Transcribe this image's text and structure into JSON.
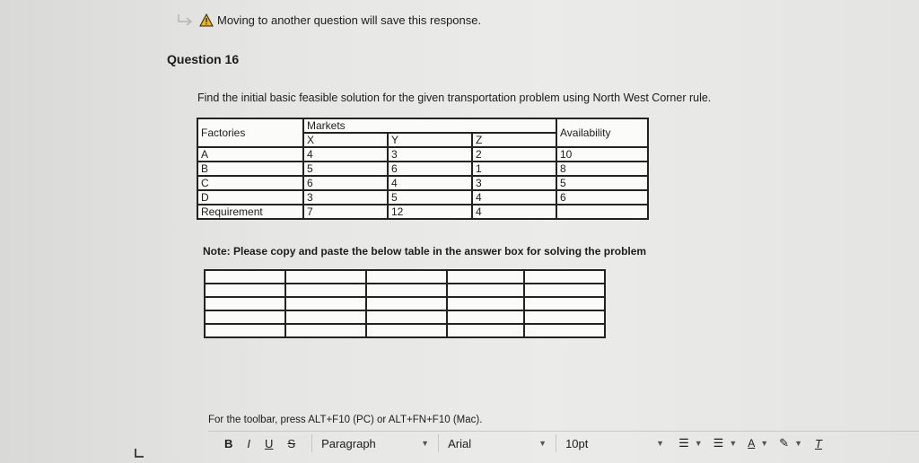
{
  "warning": {
    "text": "Moving to another question will save this response."
  },
  "question": {
    "title": "Question 16",
    "text": "Find the initial basic feasible solution for the given transportation problem using North West Corner rule."
  },
  "table": {
    "factories_header": "Factories",
    "markets_header": "Markets",
    "availability_header": "Availability",
    "market_cols": [
      "X",
      "Y",
      "Z"
    ],
    "rows": [
      {
        "label": "A",
        "x": "4",
        "y": "3",
        "z": "2",
        "avail": "10"
      },
      {
        "label": "B",
        "x": "5",
        "y": "6",
        "z": "1",
        "avail": "8"
      },
      {
        "label": "C",
        "x": "6",
        "y": "4",
        "z": "3",
        "avail": "5"
      },
      {
        "label": "D",
        "x": "3",
        "y": "5",
        "z": "4",
        "avail": "6"
      }
    ],
    "requirement": {
      "label": "Requirement",
      "x": "7",
      "y": "12",
      "z": "4"
    }
  },
  "note": "Note: Please copy and paste the below table in the answer box for solving the problem",
  "editor": {
    "hint": "For the toolbar, press ALT+F10 (PC) or ALT+FN+F10 (Mac).",
    "bold": "B",
    "italic": "I",
    "underline": "U",
    "strike": "S",
    "paragraph": "Paragraph",
    "font": "Arial",
    "size": "10pt",
    "text_color": "A",
    "clear_format": "T"
  }
}
